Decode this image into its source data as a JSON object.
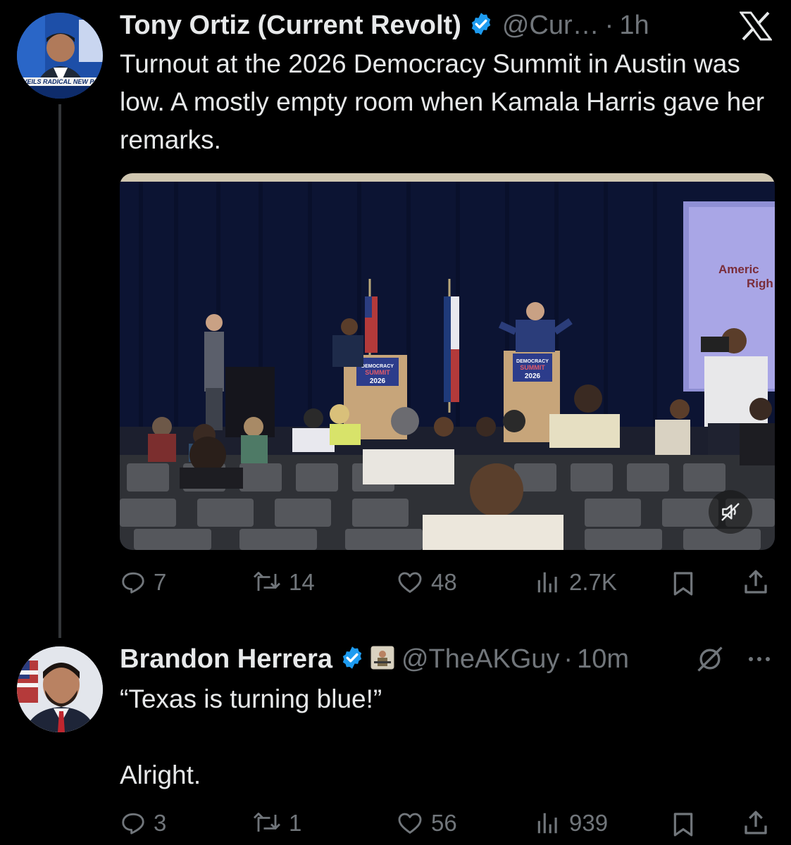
{
  "tweet1": {
    "author_name": "Tony Ortiz (Current Revolt)",
    "handle": "@Cur…",
    "separator": "·",
    "time": "1h",
    "text": "Turnout at the 2026 Democracy Summit in Austin was low. A mostly empty room when Kamala Harris gave her remarks.",
    "avatar_banner_text": "NVEILS RADICAL NEW P",
    "media": {
      "podium_sign_line1": "DEMOCRACY",
      "podium_sign_line2": "SUMMIT",
      "podium_sign_line3": "2026",
      "screen_text_1": "Americ",
      "screen_text_2": "Righ"
    },
    "actions": {
      "replies": "7",
      "reposts": "14",
      "likes": "48",
      "views": "2.7K"
    },
    "icons": {
      "verified": "verified-badge-icon",
      "platform": "x-logo-icon",
      "mute": "speaker-muted-icon"
    }
  },
  "tweet2": {
    "author_name": "Brandon Herrera",
    "handle": "@TheAKGuy",
    "separator": "·",
    "time": "10m",
    "text_line1": "“Texas is turning blue!”",
    "text_line2": "Alright.",
    "actions": {
      "replies": "3",
      "reposts": "1",
      "likes": "56",
      "views": "939"
    },
    "icons": {
      "verified": "verified-badge-icon",
      "affiliate": "affiliate-avatar-icon",
      "grok": "grok-icon",
      "more": "more-dots-icon"
    }
  },
  "colors": {
    "background": "#000000",
    "text_primary": "#e7e9ea",
    "text_secondary": "#71767b",
    "verified_blue": "#1d9bf0",
    "thread_line": "#333639"
  }
}
